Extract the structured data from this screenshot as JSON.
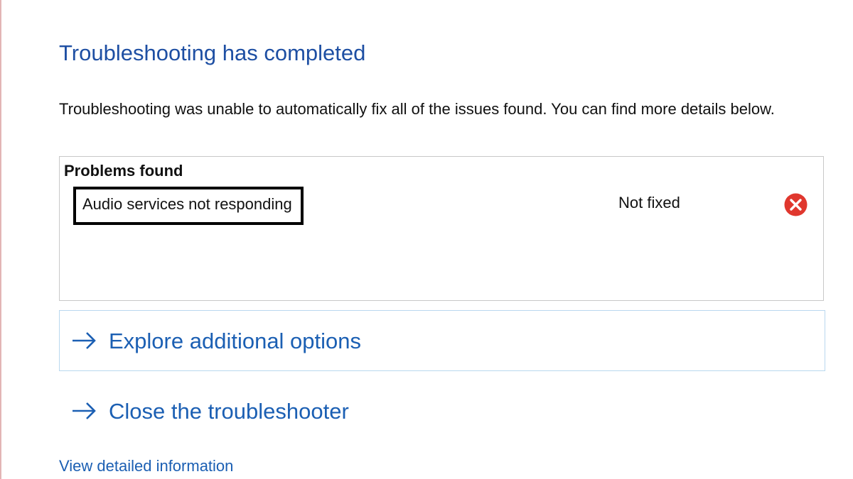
{
  "title": "Troubleshooting has completed",
  "description": "Troubleshooting was unable to automatically fix all of the issues found. You can find more details below.",
  "problems": {
    "header": "Problems found",
    "items": [
      {
        "name": "Audio services not responding",
        "status": "Not fixed",
        "status_icon": "error-icon"
      }
    ]
  },
  "options": {
    "explore": {
      "label": "Explore additional options",
      "icon": "arrow-right-icon"
    },
    "close": {
      "label": "Close the troubleshooter",
      "icon": "arrow-right-icon"
    }
  },
  "details_link": "View detailed information",
  "colors": {
    "title": "#1e4fa3",
    "link": "#1b5fb3",
    "error": "#e0372e",
    "option_border": "#b9d8ef",
    "box_border": "#c8c8c8"
  }
}
